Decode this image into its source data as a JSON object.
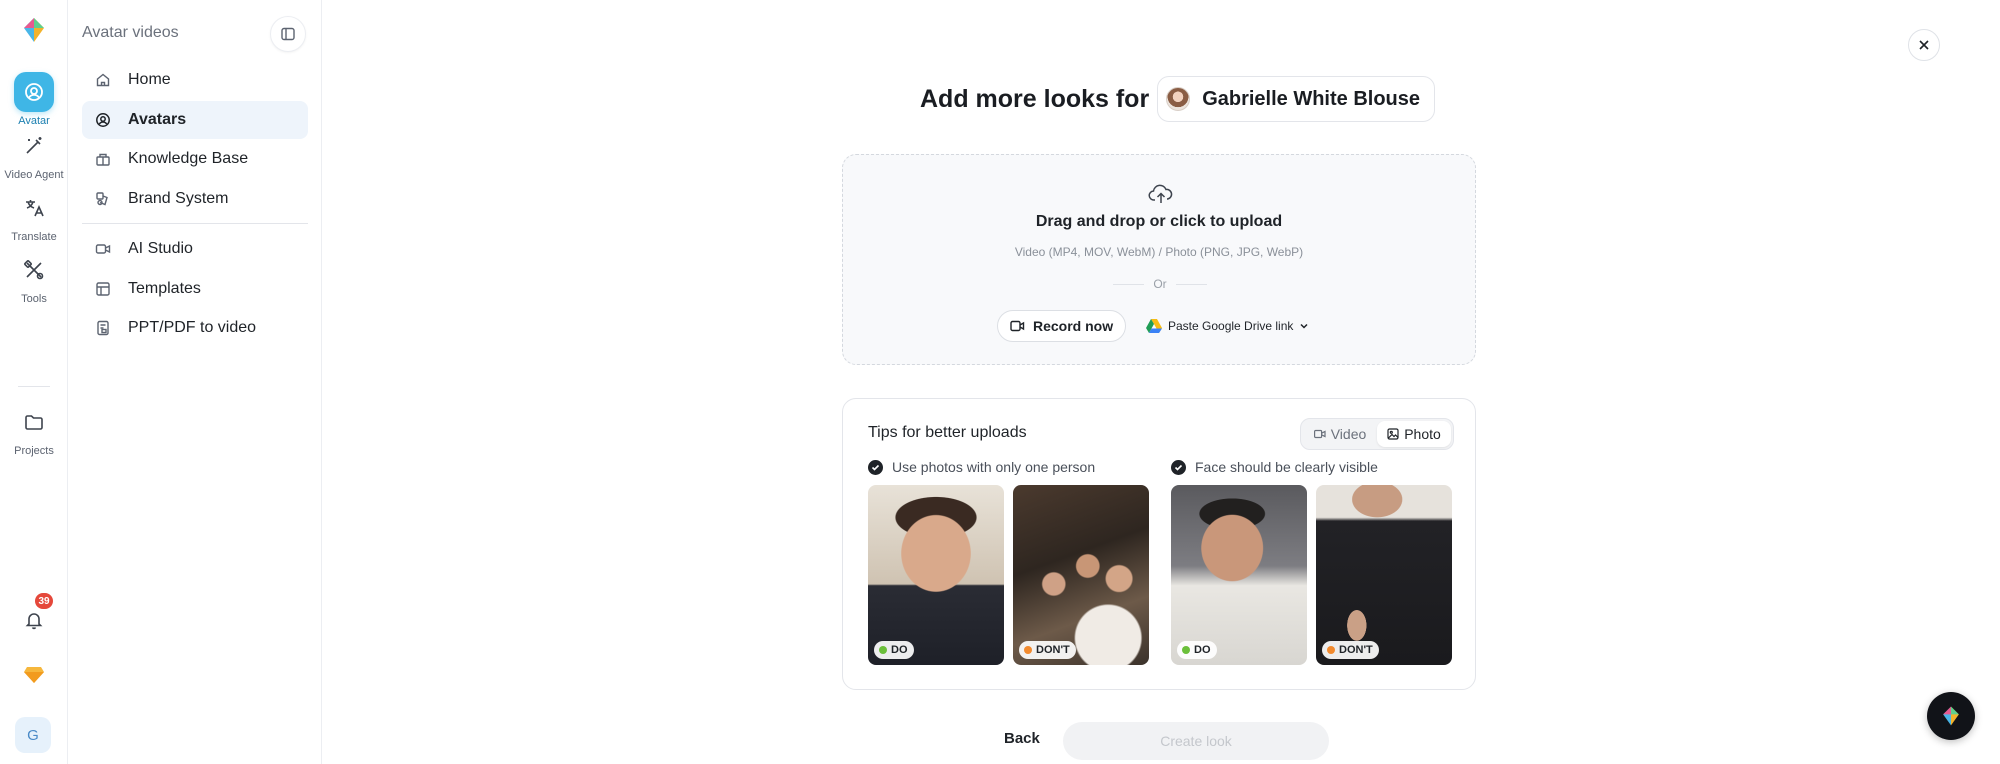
{
  "rail": {
    "items": [
      {
        "label": "Avatar",
        "icon": "avatar-icon"
      },
      {
        "label": "Video Agent",
        "icon": "magic-wand-icon"
      },
      {
        "label": "Translate",
        "icon": "translate-icon"
      },
      {
        "label": "Tools",
        "icon": "tools-icon"
      },
      {
        "label": "Projects",
        "icon": "folder-icon"
      }
    ],
    "notification_count": "39",
    "user_initial": "G"
  },
  "sidebar": {
    "title": "Avatar videos",
    "items": [
      {
        "label": "Home",
        "icon": "home-icon"
      },
      {
        "label": "Avatars",
        "icon": "avatars-icon"
      },
      {
        "label": "Knowledge Base",
        "icon": "knowledge-base-icon"
      },
      {
        "label": "Brand System",
        "icon": "brand-system-icon"
      },
      {
        "label": "AI Studio",
        "icon": "video-camera-icon"
      },
      {
        "label": "Templates",
        "icon": "templates-icon"
      },
      {
        "label": "PPT/PDF to video",
        "icon": "document-icon"
      }
    ]
  },
  "main": {
    "heading_prefix": "Add more looks for",
    "avatar_name": "Gabrielle White Blouse",
    "upload": {
      "title": "Drag and drop or click to upload",
      "formats": "Video (MP4, MOV, WebM) / Photo (PNG, JPG, WebP)",
      "or": "Or",
      "record_label": "Record now",
      "drive_label": "Paste Google Drive link"
    },
    "tips": {
      "title": "Tips for better uploads",
      "toggle": [
        "Video",
        "Photo"
      ],
      "selected": "Photo",
      "rules": [
        {
          "text": "Use photos with only one person",
          "examples": [
            {
              "tag": "DO"
            },
            {
              "tag": "DON'T"
            }
          ]
        },
        {
          "text": "Face should be clearly visible",
          "examples": [
            {
              "tag": "DO"
            },
            {
              "tag": "DON'T"
            }
          ]
        }
      ]
    },
    "back_label": "Back",
    "create_label": "Create look"
  },
  "colors": {
    "accent": "#3fb6e6",
    "do": "#6bbf3a",
    "dont": "#f28a2e",
    "badge": "#e5483b"
  }
}
